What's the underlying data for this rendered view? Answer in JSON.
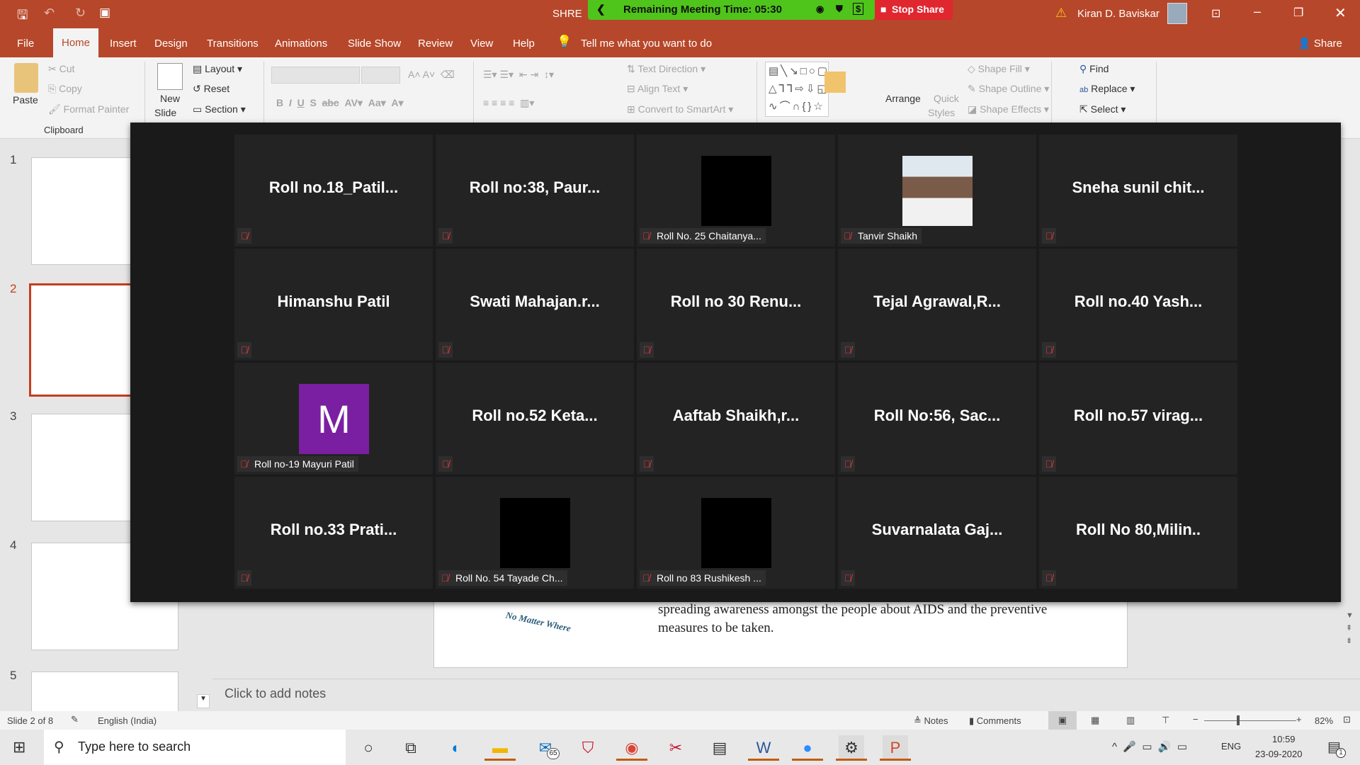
{
  "titlebar": {
    "doc_title_partial": "SHRE",
    "user": "Kiran D. Baviskar",
    "meeting_time_label": "Remaining Meeting Time: 05:30",
    "stop_share": "Stop Share"
  },
  "tabs": [
    "File",
    "Home",
    "Insert",
    "Design",
    "Transitions",
    "Animations",
    "Slide Show",
    "Review",
    "View",
    "Help"
  ],
  "tell_me": "Tell me what you want to do",
  "share": "Share",
  "ribbon": {
    "paste": "Paste",
    "cut": "Cut",
    "copy": "Copy",
    "format_painter": "Format Painter",
    "clipboard": "Clipboard",
    "new_slide_1": "New",
    "new_slide_2": "Slide",
    "layout": "Layout",
    "reset": "Reset",
    "section": "Section",
    "text_direction": "Text Direction",
    "align_text": "Align Text",
    "convert_smartart": "Convert to SmartArt",
    "arrange": "Arrange",
    "quick_styles_1": "Quick",
    "quick_styles_2": "Styles",
    "shape_fill": "Shape Fill",
    "shape_outline": "Shape Outline",
    "shape_effects": "Shape Effects",
    "find": "Find",
    "replace": "Replace",
    "select": "Select"
  },
  "slides": [
    "1",
    "2",
    "3",
    "4",
    "5"
  ],
  "participants": [
    {
      "name": "Roll  no.18_Patil...",
      "type": "name"
    },
    {
      "name": "Roll no:38, Paur...",
      "type": "name"
    },
    {
      "name": "Roll No. 25 Chaitanya...",
      "type": "video"
    },
    {
      "name": "Tanvir Shaikh",
      "type": "photo"
    },
    {
      "name": "Sneha sunil chit...",
      "type": "name"
    },
    {
      "name": "Himanshu Patil",
      "type": "name"
    },
    {
      "name": "Swati  Mahajan.r...",
      "type": "name"
    },
    {
      "name": "Roll no 30 Renu...",
      "type": "name"
    },
    {
      "name": "Tejal  Agrawal,R...",
      "type": "name"
    },
    {
      "name": "Roll no.40 Yash...",
      "type": "name"
    },
    {
      "name": "Roll no-19 Mayuri Patil",
      "type": "avatar",
      "initial": "M",
      "color": "#7b1fa2"
    },
    {
      "name": "Roll no.52 Keta...",
      "type": "name"
    },
    {
      "name": "Aaftab  Shaikh,r...",
      "type": "name"
    },
    {
      "name": "Roll No:56, Sac...",
      "type": "name"
    },
    {
      "name": "Roll no.57 virag...",
      "type": "name"
    },
    {
      "name": "Roll no.33 Prati...",
      "type": "name"
    },
    {
      "name": "Roll No. 54 Tayade Ch...",
      "type": "video"
    },
    {
      "name": "Roll no 83 Rushikesh ...",
      "type": "video"
    },
    {
      "name": "Suvarnalata  Gaj...",
      "type": "name"
    },
    {
      "name": "Roll No  80,Milin..",
      "type": "name"
    }
  ],
  "slide_text": {
    "line1": "spreading awareness amongst the people about AIDS and the preventive",
    "line2": "measures to be taken.",
    "logo_text": "No Matter Where"
  },
  "notes_placeholder": "Click to add notes",
  "status": {
    "slide": "Slide 2 of 8",
    "language": "English (India)",
    "notes": "Notes",
    "comments": "Comments",
    "zoom": "82%"
  },
  "taskbar": {
    "search_placeholder": "Type here to search",
    "mail_badge": "65",
    "lang": "ENG",
    "time": "10:59",
    "date": "23-09-2020",
    "notif": "1"
  }
}
